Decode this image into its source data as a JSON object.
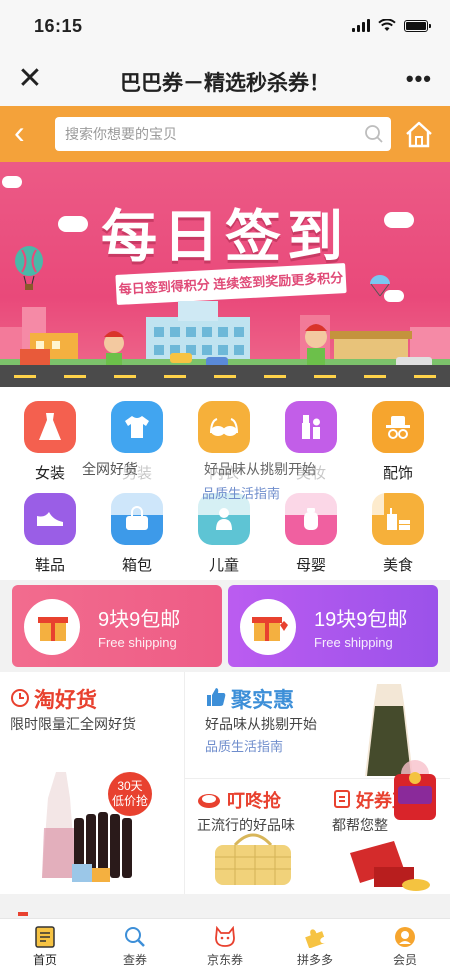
{
  "status_bar": {
    "time": "16:15"
  },
  "nav": {
    "title": "巴巴券－精选秒杀券！",
    "close_icon": "close-icon",
    "more_icon": "more-icon"
  },
  "search": {
    "placeholder": "搜索你想要的宝贝"
  },
  "banner": {
    "title": "每日签到",
    "subtitle": "每日签到得积分 连续签到奖励更多积分"
  },
  "categories": [
    {
      "label": "女装",
      "icon": "dress-icon",
      "color": "#f4604f"
    },
    {
      "label": "男装",
      "icon": "shirt-icon",
      "color": "#41a5f0"
    },
    {
      "label": "内衣",
      "icon": "bra-icon",
      "color": "#f6b03a"
    },
    {
      "label": "美妆",
      "icon": "makeup-icon",
      "color": "#c25ee8"
    },
    {
      "label": "配饰",
      "icon": "hat-icon",
      "color": "#f6a52e"
    },
    {
      "label": "鞋品",
      "icon": "shoe-icon",
      "color": "#9a5ee6"
    },
    {
      "label": "箱包",
      "icon": "bag-icon",
      "color": "#3d9ae9"
    },
    {
      "label": "儿童",
      "icon": "kid-icon",
      "color": "#5ec4d4"
    },
    {
      "label": "母婴",
      "icon": "baby-icon",
      "color": "#f060a0"
    },
    {
      "label": "美食",
      "icon": "food-icon",
      "color": "#f6b03a"
    }
  ],
  "overlay": {
    "text1": "全网好货",
    "text2": "好品味从挑剔开始",
    "text3": "品质生活指南"
  },
  "promos": [
    {
      "title": "9块9包邮",
      "subtitle": "Free shipping"
    },
    {
      "title": "19块9包邮",
      "subtitle": "Free shipping"
    }
  ],
  "features": {
    "taohaohuo": {
      "title": "淘好货",
      "subtitle": "限时限量汇全网好货",
      "badge_line1": "30天",
      "badge_line2": "低价抢"
    },
    "jushihui": {
      "title": "聚实惠",
      "subtitle": "好品味从挑剔开始",
      "link": "品质生活指南"
    },
    "dingdongqiang": {
      "title": "叮咚抢",
      "subtitle": "正流行的好品味"
    },
    "haoquan": {
      "title": "好券直",
      "subtitle": "都帮您整"
    }
  },
  "tabs": [
    {
      "label": "首页",
      "icon": "home-tab-icon"
    },
    {
      "label": "查券",
      "icon": "search-tab-icon"
    },
    {
      "label": "京东券",
      "icon": "dog-tab-icon"
    },
    {
      "label": "拼多多",
      "icon": "puzzle-tab-icon"
    },
    {
      "label": "会员",
      "icon": "member-tab-icon"
    }
  ],
  "colors": {
    "accent": "#f4a23a",
    "banner": "#e9497a",
    "red": "#e8412f",
    "blue": "#3d8fd8"
  }
}
